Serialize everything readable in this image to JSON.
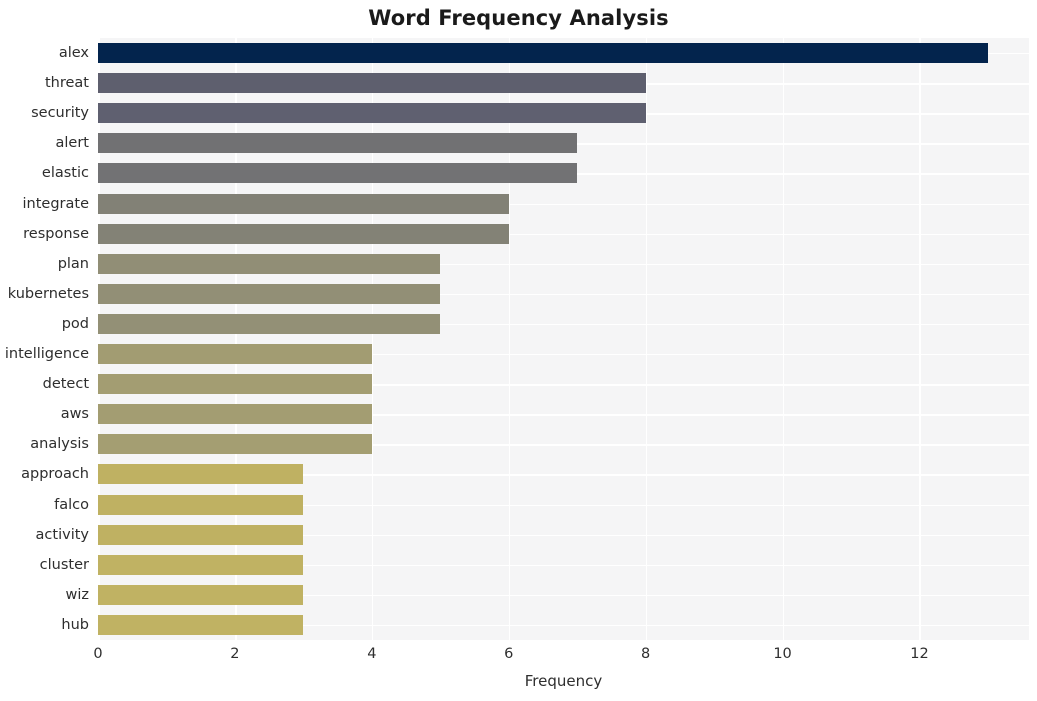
{
  "chart_data": {
    "type": "bar",
    "orientation": "horizontal",
    "title": "Word Frequency Analysis",
    "xlabel": "Frequency",
    "ylabel": "",
    "xlim": [
      0,
      13.6
    ],
    "xticks": [
      0,
      2,
      4,
      6,
      8,
      10,
      12
    ],
    "grid": true,
    "legend": null,
    "categories": [
      "alex",
      "threat",
      "security",
      "alert",
      "elastic",
      "integrate",
      "response",
      "plan",
      "kubernetes",
      "pod",
      "intelligence",
      "detect",
      "aws",
      "analysis",
      "approach",
      "falco",
      "activity",
      "cluster",
      "wiz",
      "hub"
    ],
    "values": [
      13,
      8,
      8,
      7,
      7,
      6,
      6,
      5,
      5,
      5,
      4,
      4,
      4,
      4,
      3,
      3,
      3,
      3,
      3,
      3
    ],
    "bar_colors": [
      "#03244d",
      "#5e5f6e",
      "#5f6070",
      "#717173",
      "#727274",
      "#828176",
      "#838276",
      "#918e76",
      "#928f76",
      "#939076",
      "#a29c72",
      "#a39d72",
      "#a39d72",
      "#a49e72",
      "#bfb162",
      "#bfb162",
      "#bfb162",
      "#c0b263",
      "#c0b263",
      "#c0b263"
    ]
  },
  "style": {
    "figure_background": "#ffffff",
    "axes_background": "#f5f5f6",
    "gridline_color": "#ffffff",
    "text_color": "#2e2e2e",
    "title_color": "#1a1a1a"
  }
}
